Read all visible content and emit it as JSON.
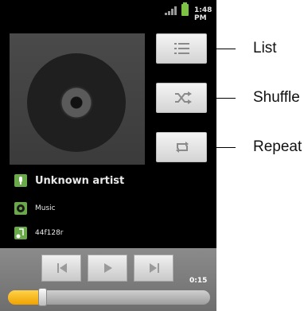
{
  "status_bar": {
    "time": "1:48 PM",
    "icons": [
      "signal-icon",
      "battery-icon"
    ]
  },
  "album_art": {
    "icon": "disc-icon"
  },
  "controls": {
    "list_icon": "list-icon",
    "shuffle_icon": "shuffle-icon",
    "repeat_icon": "repeat-icon"
  },
  "callouts": {
    "list": "List",
    "shuffle": "Shuffle",
    "repeat": "Repeat"
  },
  "track_info": {
    "artist": "Unknown artist",
    "album": "Music",
    "title": "44f128r"
  },
  "player": {
    "elapsed": "0:15",
    "progress_fraction": 0.17,
    "buttons": [
      "previous-icon",
      "play-icon",
      "next-icon"
    ]
  },
  "colors": {
    "accent": "#f0a200",
    "icon_green": "#6aa94a"
  }
}
